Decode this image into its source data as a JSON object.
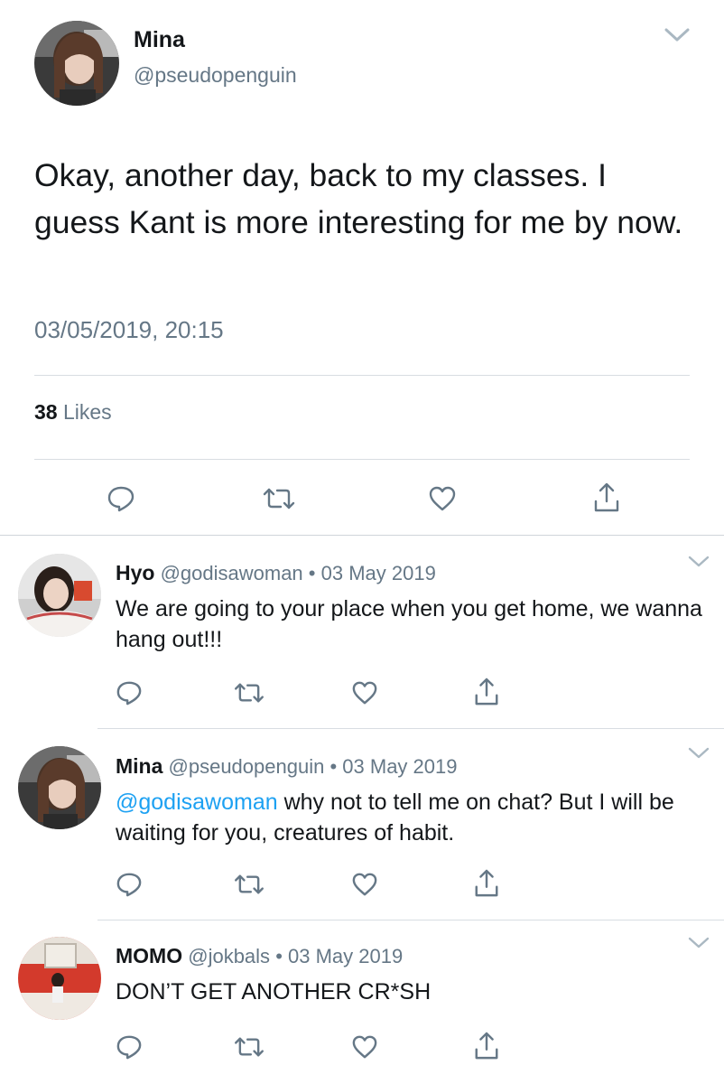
{
  "main_tweet": {
    "author_name": "Mina",
    "author_handle": "@pseudopenguin",
    "text": "Okay, another day, back to my classes. I guess Kant is more interesting for me by now.",
    "timestamp": "03/05/2019, 20:15",
    "likes_count": "38",
    "likes_label": "Likes",
    "actions": [
      "reply-icon",
      "retweet-icon",
      "like-icon",
      "share-icon"
    ]
  },
  "replies": [
    {
      "name": "Hyo",
      "handle": "@godisawoman",
      "separator": "•",
      "date": "03 May 2019",
      "mention": "",
      "text": "We are going to your place when you get home, we wanna hang out!!!"
    },
    {
      "name": "Mina",
      "handle": "@pseudopenguin",
      "separator": "•",
      "date": "03 May 2019",
      "mention": "@godisawoman",
      "text": " why not to tell me on chat? But I will be waiting for you, creatures of habit."
    },
    {
      "name": "MOMO",
      "handle": "@jokbals",
      "separator": "•",
      "date": "03 May 2019",
      "mention": "",
      "text": "DON’T GET ANOTHER CR*SH"
    }
  ],
  "colors": {
    "text_primary": "#14171a",
    "text_secondary": "#657786",
    "accent_link": "#1da1f2",
    "divider": "#d8dde2"
  }
}
